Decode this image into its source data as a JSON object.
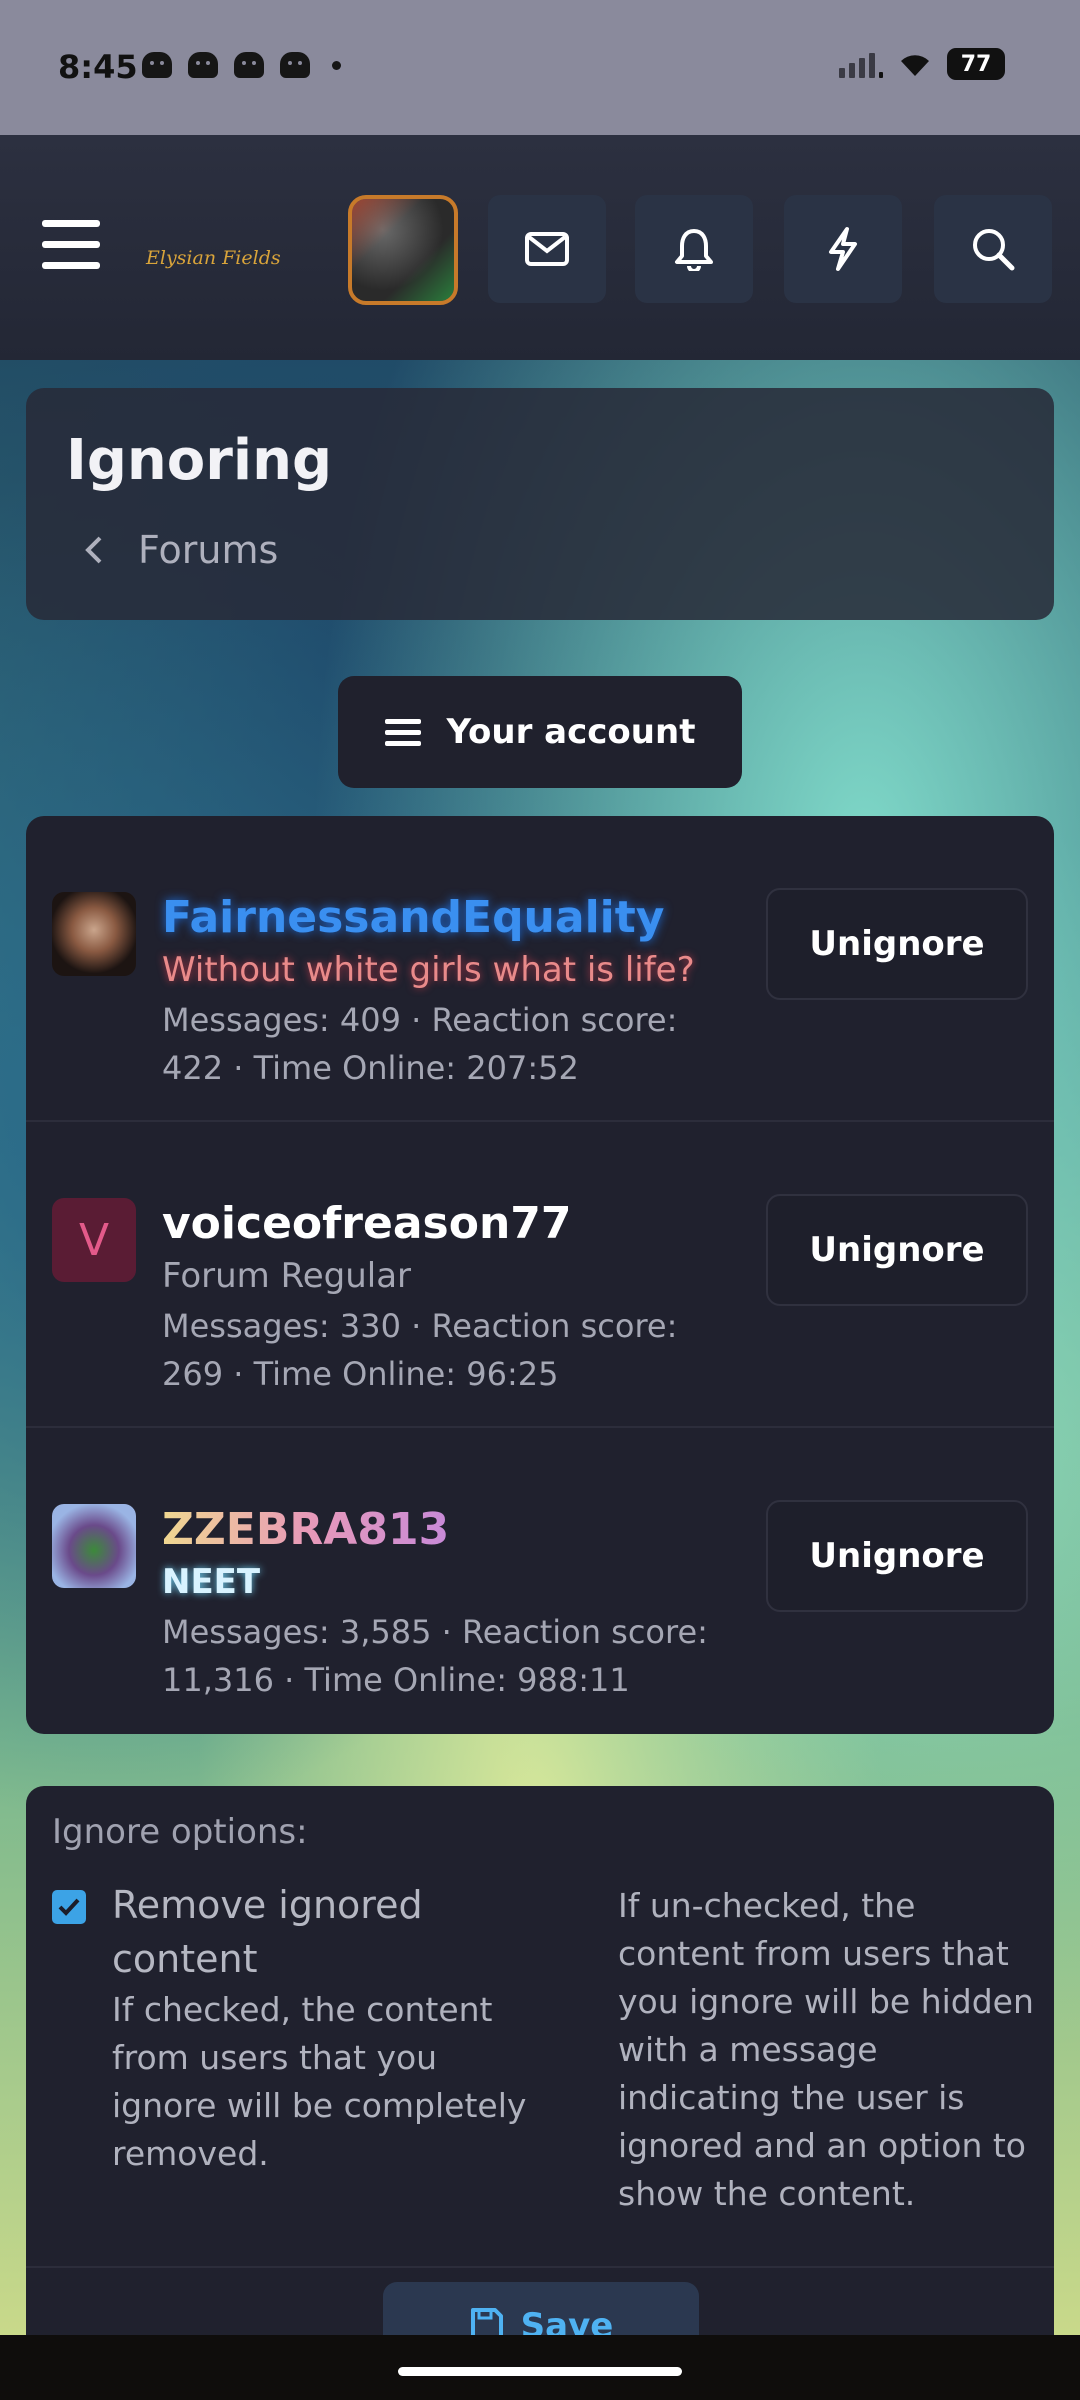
{
  "status_bar": {
    "time": "8:45",
    "battery": "77"
  },
  "header": {
    "logo_text": "Elysian Fields"
  },
  "page": {
    "title": "Ignoring",
    "breadcrumb": "Forums"
  },
  "account_menu": {
    "label": "Your account"
  },
  "ignored_users": [
    {
      "name": "FairnessandEquality",
      "user_title": "Without white girls what is life?",
      "stats_line1": "Messages: 409 · Reaction score:",
      "stats_line2": "422 · Time Online: 207:52",
      "action": "Unignore"
    },
    {
      "name": "voiceofreason77",
      "avatar_letter": "V",
      "user_title": "Forum Regular",
      "stats_line1": "Messages: 330 · Reaction score:",
      "stats_line2": "269 · Time Online: 96:25",
      "action": "Unignore"
    },
    {
      "name": "ZZEBRA813",
      "user_title": "NEET",
      "stats_line1": "Messages: 3,585 · Reaction score:",
      "stats_line2": "11,316 · Time Online: 988:11",
      "action": "Unignore"
    }
  ],
  "ignore_options": {
    "label": "Ignore options:",
    "remove_checked": true,
    "remove_title": "Remove ignored content",
    "remove_desc": "If checked, the content from users that you ignore will be completely removed.",
    "unchecked_desc": "If un-checked, the content from users that you ignore will be hidden with a message indicating the user is ignored and an option to show the content.",
    "save_label": "Save"
  },
  "colors": {
    "accent": "#3ca3e6",
    "name_fairness": "#3a8ff0",
    "title_fairness": "#e98a8a",
    "avatar_v_bg": "#5a1c34",
    "avatar_v_fg": "#e35a8a",
    "title_neet": "#d8f3ff"
  }
}
